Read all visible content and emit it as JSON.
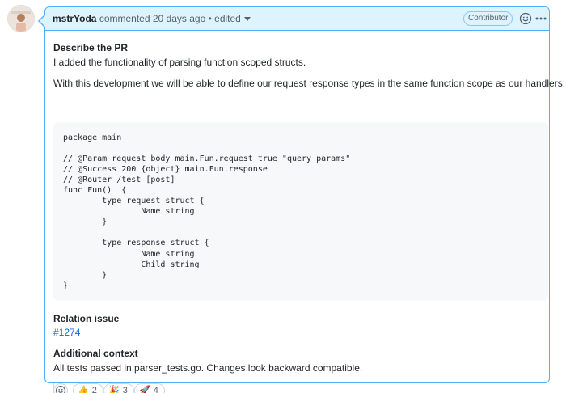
{
  "comment": {
    "author": "mstrYoda",
    "action": "commented",
    "time_ago": "20 days ago",
    "separator": "•",
    "edited": "edited",
    "badge": "Contributor",
    "icons": {
      "reaction_header": "smiley-icon",
      "menu": "kebab-icon",
      "edited_dropdown": "triangle-down-icon"
    }
  },
  "body": {
    "heading_pr": "Describe the PR",
    "pr_text": "I added the functionality of parsing function scoped structs.",
    "dev_text": "With this development we will be able to define our request response types in the same function scope as our handlers:",
    "code": "package main\n\n// @Param request body main.Fun.request true \"query params\"\n// @Success 200 {object} main.Fun.response\n// @Router /test [post]\nfunc Fun()  {\n        type request struct {\n                Name string\n        }\n\n        type response struct {\n                Name string\n                Child string\n        }\n}",
    "heading_relation": "Relation issue",
    "relation_link": "#1274",
    "heading_context": "Additional context",
    "context_text": "All tests passed in parser_tests.go. Changes look backward compatible."
  },
  "reactions": [
    {
      "emoji": "👍",
      "icon": "thumbs-up-icon",
      "count": "2"
    },
    {
      "emoji": "🎉",
      "icon": "party-popper-icon",
      "count": "3"
    },
    {
      "emoji": "🚀",
      "icon": "rocket-icon",
      "count": "4"
    }
  ],
  "colors": {
    "header_bg": "#ddf4ff",
    "border_accent": "#54aeff",
    "link": "#0969da",
    "code_bg": "#f6f8fa"
  }
}
